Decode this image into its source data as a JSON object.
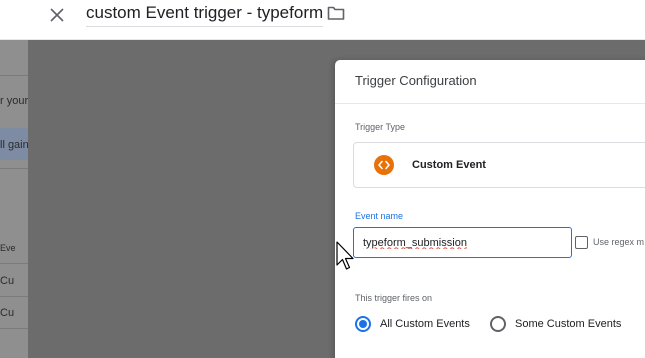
{
  "header": {
    "title": "custom Event trigger - typeform",
    "close_icon": "close-icon",
    "folder_icon": "folder-icon"
  },
  "background": {
    "rows": [
      "r your",
      "ll gain",
      "Eve",
      "Cu",
      "Cu"
    ]
  },
  "trigger_config": {
    "title": "Trigger Configuration",
    "type_label": "Trigger Type",
    "type_value": "Custom Event",
    "type_icon": "code-icon",
    "accent_color": "#e8710a",
    "event_name_label": "Event name",
    "event_name_value": "typeform_submission",
    "regex_label": "Use regex m",
    "fires_on_label": "This trigger fires on",
    "options": [
      {
        "label": "All Custom Events",
        "selected": true
      },
      {
        "label": "Some Custom Events",
        "selected": false
      }
    ],
    "focus_color": "#1a73e8"
  }
}
